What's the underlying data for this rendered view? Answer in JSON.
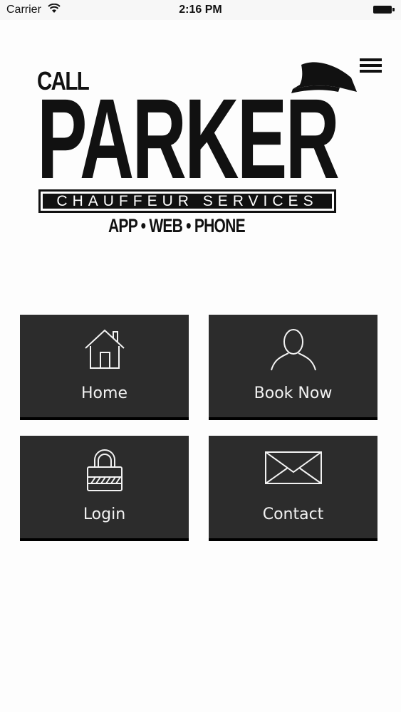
{
  "status_bar": {
    "carrier": "Carrier",
    "time": "2:16 PM"
  },
  "logo": {
    "call": "CALL",
    "name": "PARKER",
    "subtitle": "CHAUFFEUR SERVICES",
    "tagline": "APP • WEB • PHONE"
  },
  "tiles": [
    {
      "label": "Home",
      "icon": "house-icon"
    },
    {
      "label": "Book Now",
      "icon": "person-icon"
    },
    {
      "label": "Login",
      "icon": "padlock-icon"
    },
    {
      "label": "Contact",
      "icon": "envelope-icon"
    }
  ],
  "colors": {
    "tile_bg": "#2c2c2c",
    "tile_text": "#f2f2f2",
    "page_bg": "#fdfdfd"
  }
}
